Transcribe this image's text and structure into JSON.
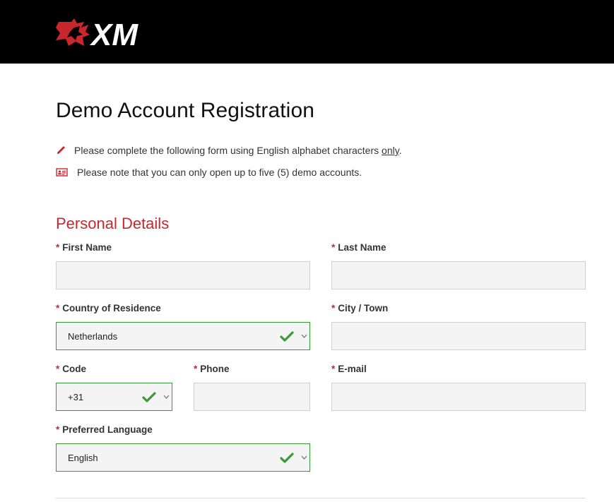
{
  "header": {
    "brand": "XM"
  },
  "page": {
    "title": "Demo Account Registration",
    "notice1_prefix": "Please complete the following form using English alphabet characters ",
    "notice1_emph": "only",
    "notice1_suffix": ".",
    "notice2": "Please note that you can only open up to five (5) demo accounts."
  },
  "section": {
    "title": "Personal Details"
  },
  "form": {
    "required_mark": "*",
    "first_name": {
      "label": "First Name",
      "value": ""
    },
    "last_name": {
      "label": "Last Name",
      "value": ""
    },
    "country": {
      "label": "Country of Residence",
      "value": "Netherlands"
    },
    "city": {
      "label": "City / Town",
      "value": ""
    },
    "code": {
      "label": "Code",
      "value": "+31"
    },
    "phone": {
      "label": "Phone",
      "value": ""
    },
    "email": {
      "label": "E-mail",
      "value": ""
    },
    "language": {
      "label": "Preferred Language",
      "value": "English"
    }
  },
  "colors": {
    "brand_red": "#c9272d",
    "valid_green": "#3a9a3a",
    "header_bg": "#000000"
  },
  "icons": {
    "pencil": "pencil-icon",
    "id_card": "id-card-icon",
    "check": "check-icon",
    "chevron": "chevron-down-icon"
  }
}
